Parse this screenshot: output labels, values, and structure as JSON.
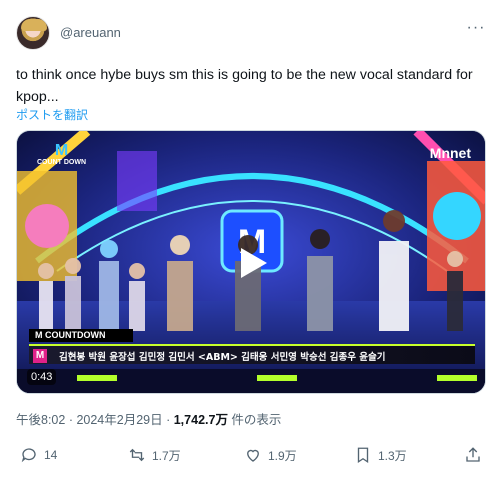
{
  "tweet": {
    "handle": "@areuann",
    "text": "to think once hybe buys sm this is going to be the new vocal standard for kpop...",
    "translate_label": "ポストを翻訳",
    "time": "午後8:02",
    "separator": " · ",
    "date": "2024年2月29日",
    "views_count": "1,742.7万",
    "views_suffix": " 件の表示"
  },
  "media": {
    "duration": "0:43",
    "channel_logo": "M",
    "channel_logo_sub": "nnet",
    "show_logo_top": "M",
    "show_logo_bottom": "COUNT DOWN",
    "lower_third_title": "M COUNTDOWN",
    "lower_third_logo": "M",
    "lower_third_names": "김현봉   박원    윤장섭 김민정    김민서 <ABM> 김태웅    서민영    박승선 김종우 윤슬기",
    "icons": [
      "play-icon"
    ]
  },
  "actions": {
    "reply_count": "14",
    "repost_count": "1.7万",
    "like_count": "1.9万",
    "bookmark_count": "1.3万",
    "icons": [
      "reply-icon",
      "repost-icon",
      "like-icon",
      "bookmark-icon",
      "share-icon",
      "more-icon"
    ]
  },
  "colors": {
    "link": "#1d9bf0",
    "secondary_text": "#536471",
    "primary_text": "#0f1419"
  }
}
